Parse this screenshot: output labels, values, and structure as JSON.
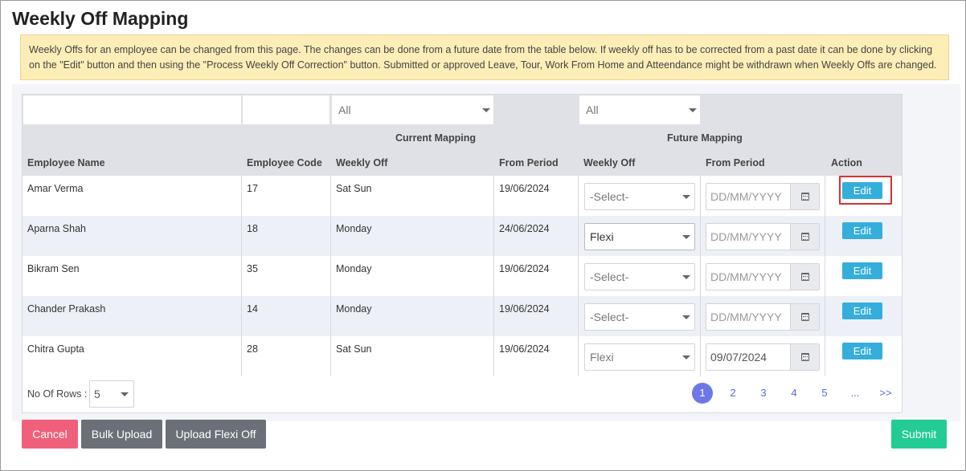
{
  "page": {
    "title": "Weekly Off Mapping",
    "notice": "Weekly Offs for an employee can be changed from this page. The changes can be done from a future date from the table below. If weekly off has to be corrected from a past date it can be done by clicking on the \"Edit\" button and then using  the \"Process Weekly Off Correction\" button. Submitted or approved Leave, Tour, Work From Home and Atteendance might be withdrawn when Weekly Offs are changed."
  },
  "filters": {
    "current_weekly_off": "All",
    "future_weekly_off": "All"
  },
  "table": {
    "group_headers": {
      "current": "Current Mapping",
      "future": "Future Mapping"
    },
    "columns": {
      "employee_name": "Employee Name",
      "employee_code": "Employee Code",
      "weekly_off": "Weekly Off",
      "from_period": "From Period",
      "future_weekly_off": "Weekly Off",
      "future_from_period": "From Period",
      "action": "Action"
    },
    "rows": [
      {
        "name": "Amar Verma",
        "code": "17",
        "weekly_off": "Sat Sun",
        "from_period": "19/06/2024",
        "future_weekly_off": "-Select-",
        "future_from_period": "DD/MM/YYYY",
        "action": "Edit"
      },
      {
        "name": "Aparna Shah",
        "code": "18",
        "weekly_off": "Monday",
        "from_period": "24/06/2024",
        "future_weekly_off": "Flexi",
        "future_from_period": "DD/MM/YYYY",
        "action": "Edit"
      },
      {
        "name": "Bikram Sen",
        "code": "35",
        "weekly_off": "Monday",
        "from_period": "19/06/2024",
        "future_weekly_off": "-Select-",
        "future_from_period": "DD/MM/YYYY",
        "action": "Edit"
      },
      {
        "name": "Chander Prakash",
        "code": "14",
        "weekly_off": "Monday",
        "from_period": "19/06/2024",
        "future_weekly_off": "-Select-",
        "future_from_period": "DD/MM/YYYY",
        "action": "Edit"
      },
      {
        "name": "Chitra Gupta",
        "code": "28",
        "weekly_off": "Sat Sun",
        "from_period": "19/06/2024",
        "future_weekly_off": "Flexi",
        "future_from_period": "09/07/2024",
        "action": "Edit"
      }
    ]
  },
  "footer": {
    "rows_label": "No Of Rows :",
    "rows_value": "5",
    "pages": [
      "1",
      "2",
      "3",
      "4",
      "5",
      "...",
      ">>"
    ],
    "active_page": "1"
  },
  "buttons": {
    "cancel": "Cancel",
    "bulk_upload": "Bulk Upload",
    "upload_flexi_off": "Upload Flexi Off",
    "submit": "Submit"
  },
  "colors": {
    "edit": "#35aedb",
    "cancel": "#f0607a",
    "neutral": "#6b7078",
    "submit": "#22cc94",
    "highlight": "#d63232",
    "notice_bg": "#fdeeb8"
  }
}
